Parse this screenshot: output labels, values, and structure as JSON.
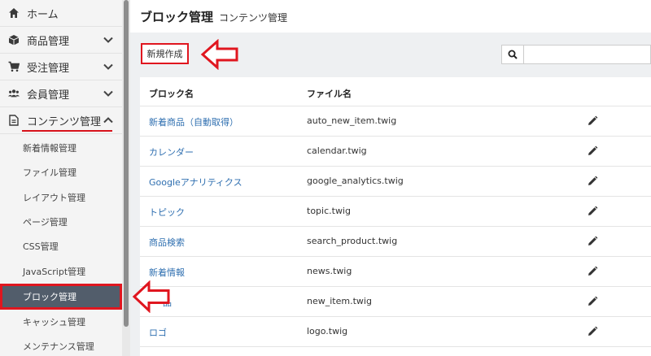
{
  "sidebar": {
    "items": [
      {
        "label": "ホーム",
        "icon": "home-icon"
      },
      {
        "label": "商品管理",
        "icon": "cube-icon"
      },
      {
        "label": "受注管理",
        "icon": "cart-icon"
      },
      {
        "label": "会員管理",
        "icon": "users-icon"
      },
      {
        "label": "コンテンツ管理",
        "icon": "document-icon"
      }
    ],
    "sub_items": [
      {
        "label": "新着情報管理"
      },
      {
        "label": "ファイル管理"
      },
      {
        "label": "レイアウト管理"
      },
      {
        "label": "ページ管理"
      },
      {
        "label": "CSS管理"
      },
      {
        "label": "JavaScript管理"
      },
      {
        "label": "ブロック管理"
      },
      {
        "label": "キャッシュ管理"
      },
      {
        "label": "メンテナンス管理"
      }
    ]
  },
  "header": {
    "title": "ブロック管理",
    "subtitle": "コンテンツ管理"
  },
  "toolbar": {
    "new_label": "新規作成",
    "search_placeholder": ""
  },
  "table": {
    "headers": [
      "ブロック名",
      "ファイル名"
    ],
    "rows": [
      {
        "name": "新着商品（自動取得）",
        "file": "auto_new_item.twig"
      },
      {
        "name": "カレンダー",
        "file": "calendar.twig"
      },
      {
        "name": "Googleアナリティクス",
        "file": "google_analytics.twig"
      },
      {
        "name": "トピック",
        "file": "topic.twig"
      },
      {
        "name": "商品検索",
        "file": "search_product.twig"
      },
      {
        "name": "新着情報",
        "file": "news.twig"
      },
      {
        "name": "品",
        "file": "new_item.twig"
      },
      {
        "name": "ロゴ",
        "file": "logo.twig"
      }
    ]
  },
  "colors": {
    "accent_red": "#e0161f",
    "selected_bg": "#525d6b",
    "link": "#2f6fb0"
  }
}
